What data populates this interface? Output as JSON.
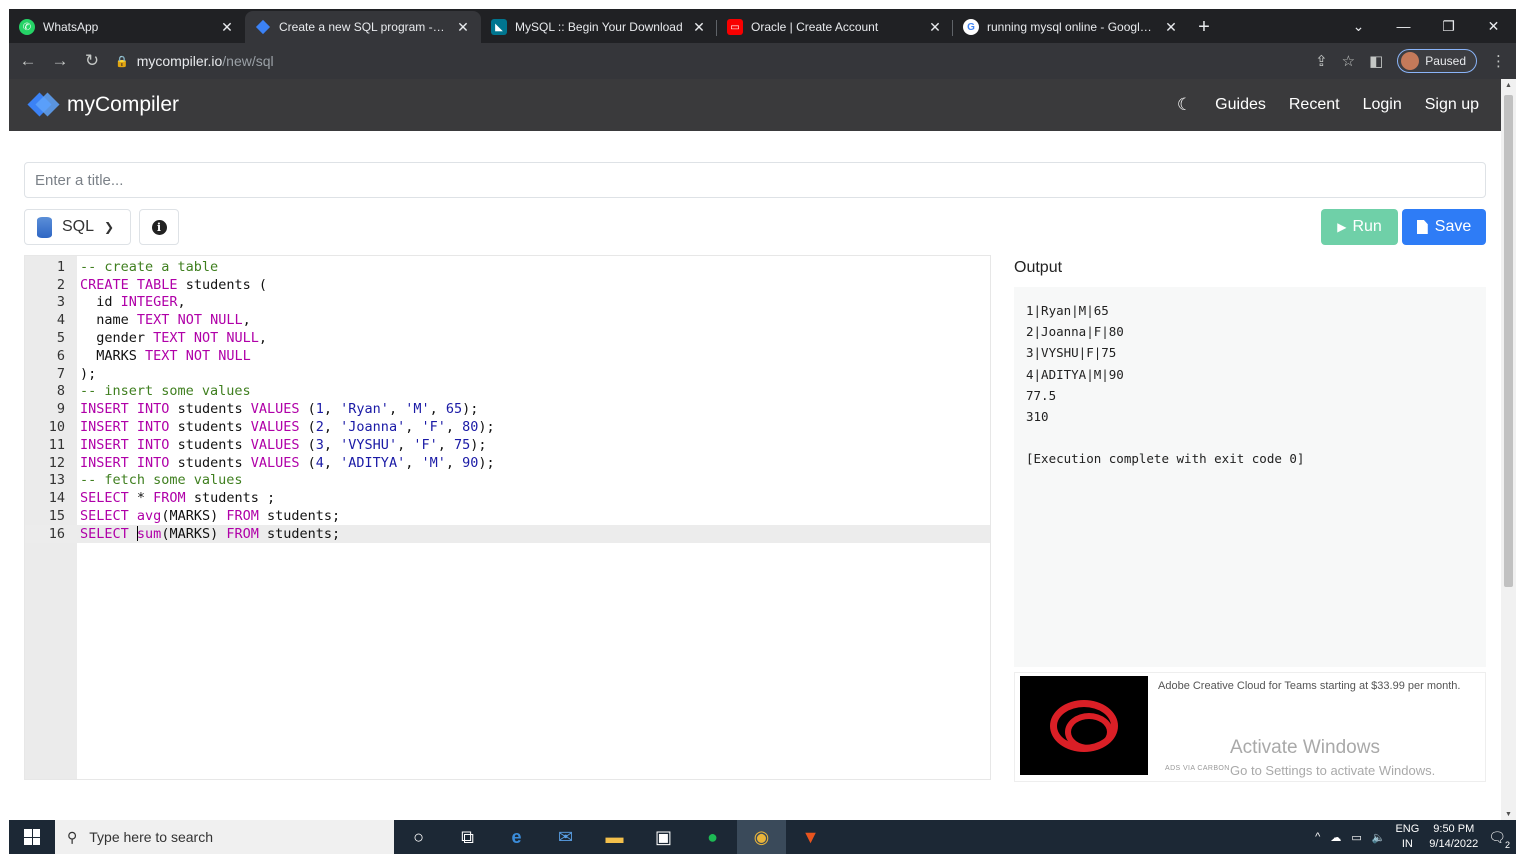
{
  "browser": {
    "tabs": [
      {
        "title": "WhatsApp",
        "color": "#25d366"
      },
      {
        "title": "Create a new SQL program - myCompiler",
        "color": "#3b82f6"
      },
      {
        "title": "MySQL :: Begin Your Download",
        "color": "#00758f"
      },
      {
        "title": "Oracle | Create Account",
        "color": "#f80000"
      },
      {
        "title": "running mysql online - Google Search",
        "color": "#ffffff"
      }
    ],
    "address_domain": "mycompiler.io",
    "address_path": "/new/sql",
    "profile_status": "Paused"
  },
  "site": {
    "brand": "myCompiler",
    "nav": {
      "guides": "Guides",
      "recent": "Recent",
      "login": "Login",
      "signup": "Sign up"
    }
  },
  "toolbar": {
    "title_placeholder": "Enter a title...",
    "language": "SQL",
    "run_label": "Run",
    "save_label": "Save"
  },
  "editor": {
    "current_line": 16,
    "lines": [
      "-- create a table",
      "CREATE TABLE students (",
      "  id INTEGER,",
      "  name TEXT NOT NULL,",
      "  gender TEXT NOT NULL,",
      "  MARKS TEXT NOT NULL",
      ");",
      "-- insert some values",
      "INSERT INTO students VALUES (1, 'Ryan', 'M', 65);",
      "INSERT INTO students VALUES (2, 'Joanna', 'F', 80);",
      "INSERT INTO students VALUES (3, 'VYSHU', 'F', 75);",
      "INSERT INTO students VALUES (4, 'ADITYA', 'M', 90);",
      "-- fetch some values",
      "SELECT * FROM students ;",
      "SELECT avg(MARKS) FROM students;",
      "SELECT sum(MARKS) FROM students;"
    ]
  },
  "output": {
    "label": "Output",
    "lines": [
      "1|Ryan|M|65",
      "2|Joanna|F|80",
      "3|VYSHU|F|75",
      "4|ADITYA|M|90",
      "77.5",
      "310",
      "",
      "[Execution complete with exit code 0]"
    ]
  },
  "ad": {
    "text": "Adobe Creative Cloud for Teams starting at $33.99 per month.",
    "via": "ADS VIA CARBON"
  },
  "watermark": {
    "line1": "Activate Windows",
    "line2": "Go to Settings to activate Windows."
  },
  "taskbar": {
    "search_placeholder": "Type here to search",
    "lang1": "ENG",
    "lang2": "IN",
    "time": "9:50 PM",
    "date": "9/14/2022",
    "notification_count": "2"
  }
}
